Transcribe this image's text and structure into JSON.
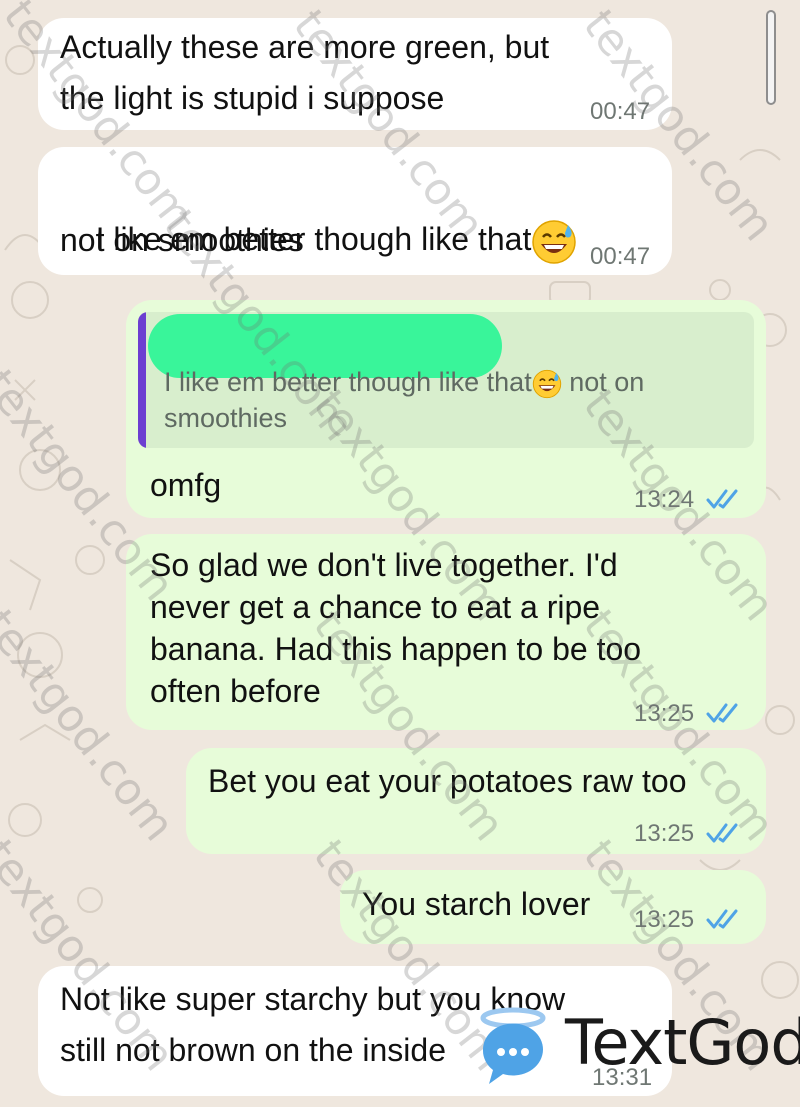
{
  "messages": [
    {
      "dir": "in",
      "lines": [
        "Actually these are more green, but",
        "the light is stupid i suppose"
      ],
      "time": "00:47"
    },
    {
      "dir": "in",
      "lines": [
        "I like em better though like that",
        "not on smoothies"
      ],
      "emoji": "sweat-smile-emoji",
      "time": "00:47"
    },
    {
      "dir": "out",
      "reply_quote": "I like em better though like that",
      "reply_quote_tail": " not on smoothies",
      "lines": [
        "omfg"
      ],
      "time": "13:24",
      "status": "read"
    },
    {
      "dir": "out",
      "lines": [
        "So glad we don't live together. I'd",
        "never get a chance to eat a ripe",
        "banana. Had this happen to be too",
        "often before"
      ],
      "time": "13:25",
      "status": "read"
    },
    {
      "dir": "out",
      "lines": [
        "Bet you eat your potatoes raw too"
      ],
      "time": "13:25",
      "status": "read"
    },
    {
      "dir": "out",
      "lines": [
        "You starch lover"
      ],
      "time": "13:25",
      "status": "read"
    },
    {
      "dir": "in",
      "lines": [
        "Not like super starchy but you know",
        "still not brown on the inside"
      ],
      "time": "13:31"
    }
  ],
  "watermark": "textgod.com",
  "logo": {
    "text": "TextGod",
    "icon": "textgod-halo-bubble-icon"
  },
  "colors": {
    "incoming": "#ffffff",
    "outgoing": "#e7fcd9",
    "read_ticks": "#4fa3e6",
    "quote_bar": "#6c3fd1",
    "redaction": "#39f59a"
  }
}
